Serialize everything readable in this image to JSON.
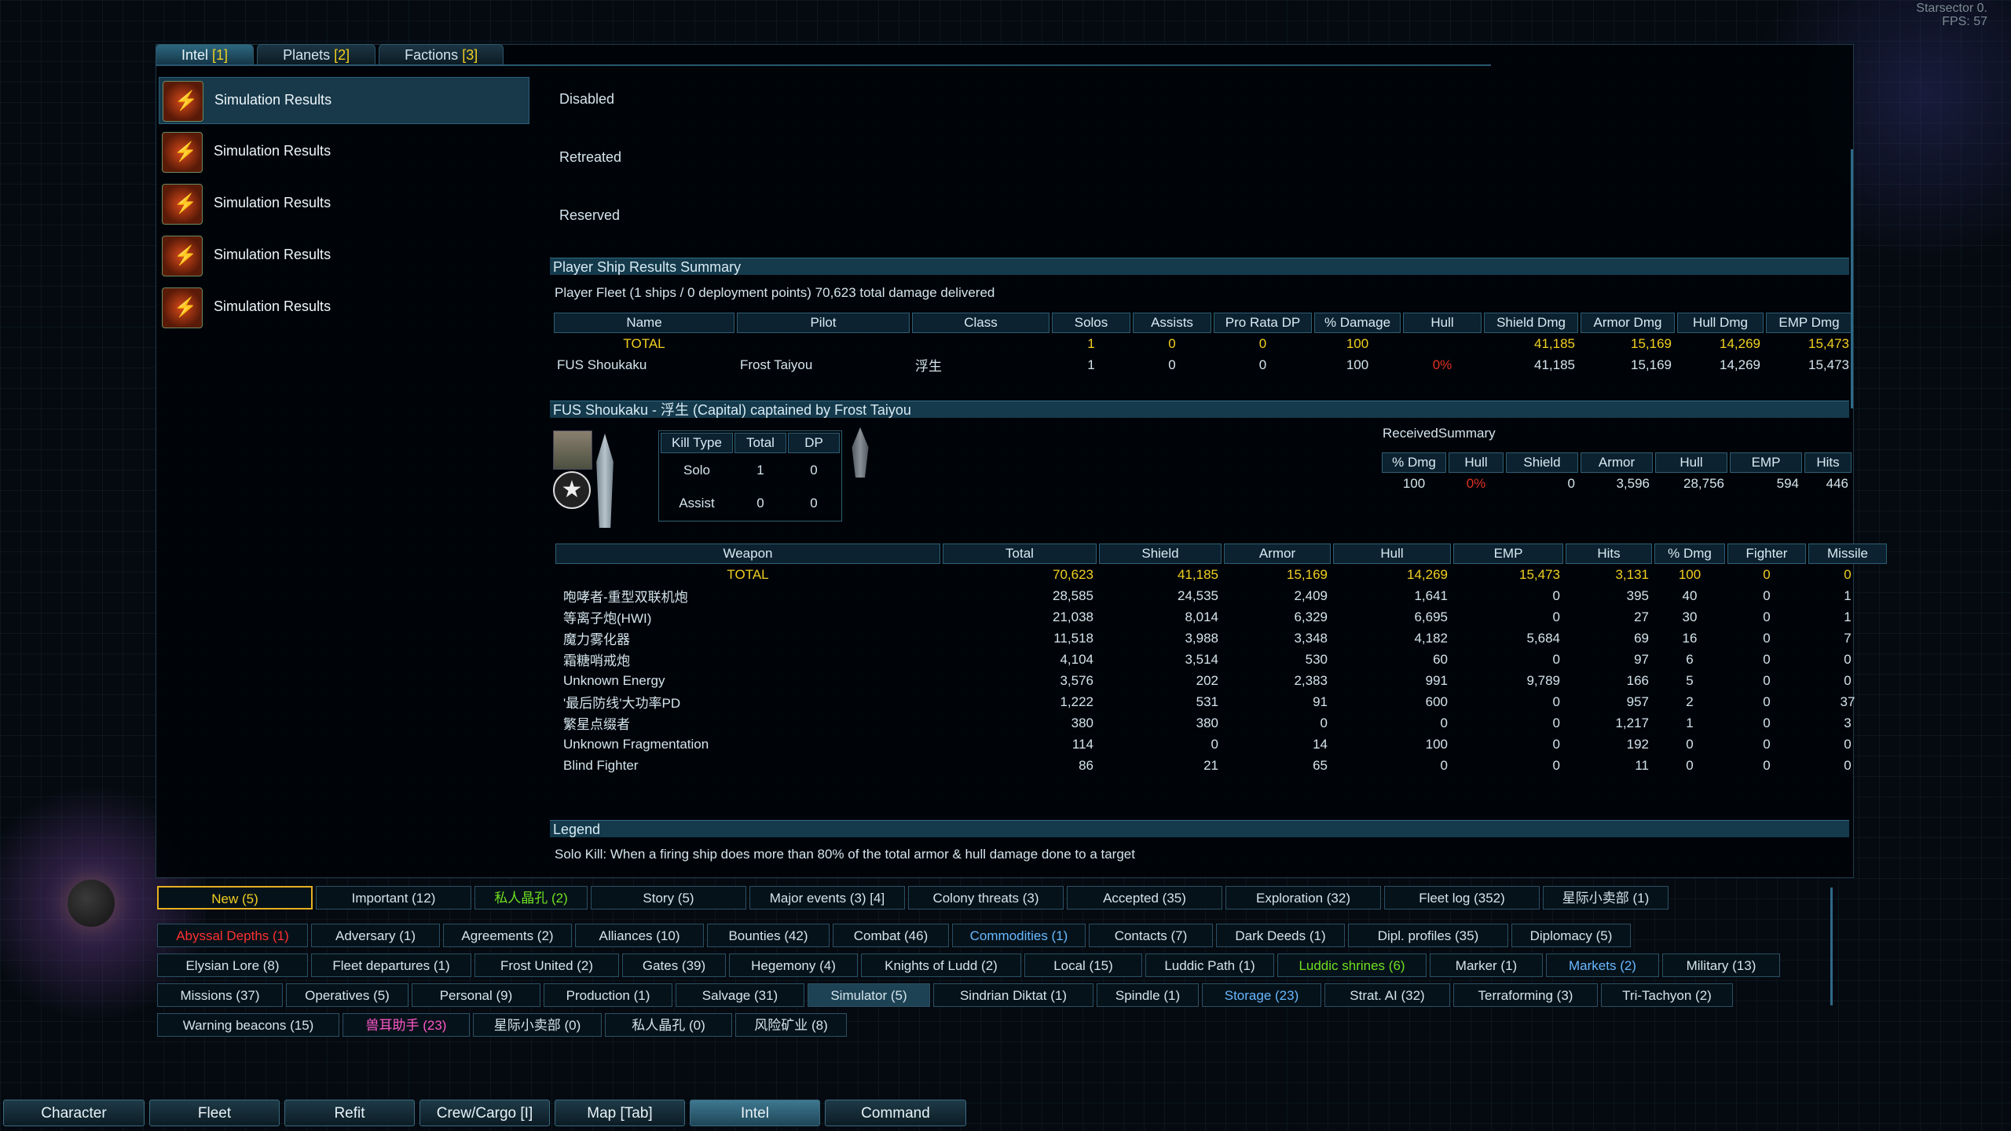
{
  "hud": {
    "game": "Starsector 0.",
    "fps_label": "FPS:",
    "fps_value": "57"
  },
  "top_tabs": [
    {
      "label": "Intel",
      "count": "[1]"
    },
    {
      "label": "Planets",
      "count": "[2]"
    },
    {
      "label": "Factions",
      "count": "[3]"
    }
  ],
  "intel_items": [
    "Simulation Results",
    "Simulation Results",
    "Simulation Results",
    "Simulation Results",
    "Simulation Results"
  ],
  "status_labels": [
    "Disabled",
    "Retreated",
    "Reserved"
  ],
  "summary": {
    "header": "Player Ship Results Summary",
    "fleet_line": "Player Fleet (1 ships / 0 deployment points) 70,623 total damage delivered",
    "columns": [
      "Name",
      "Pilot",
      "Class",
      "Solos",
      "Assists",
      "Pro Rata DP",
      "% Damage",
      "Hull",
      "Shield Dmg",
      "Armor Dmg",
      "Hull Dmg",
      "EMP Dmg"
    ],
    "total_row": [
      "TOTAL",
      "",
      "",
      "1",
      "0",
      "0",
      "100",
      "",
      "41,185",
      "15,169",
      "14,269",
      "15,473"
    ],
    "rows": [
      [
        "FUS Shoukaku",
        "Frost Taiyou",
        "浮生",
        "1",
        "0",
        "0",
        "100",
        "0%",
        "41,185",
        "15,169",
        "14,269",
        "15,473"
      ]
    ]
  },
  "ship_detail": {
    "header": "FUS Shoukaku - 浮生 (Capital) captained by Frost Taiyou",
    "kill_columns": [
      "Kill Type",
      "Total",
      "DP"
    ],
    "kill_rows": [
      [
        "Solo",
        "1",
        "0"
      ],
      [
        "Assist",
        "0",
        "0"
      ]
    ],
    "received_title": "ReceivedSummary",
    "received_columns": [
      "% Dmg",
      "Hull",
      "Shield",
      "Armor",
      "Hull",
      "EMP",
      "Hits"
    ],
    "received_row": [
      "100",
      "0%",
      "0",
      "3,596",
      "28,756",
      "594",
      "446"
    ],
    "weapon_columns": [
      "Weapon",
      "Total",
      "Shield",
      "Armor",
      "Hull",
      "EMP",
      "Hits",
      "% Dmg",
      "Fighter",
      "Missile"
    ],
    "weapon_total": [
      "TOTAL",
      "70,623",
      "41,185",
      "15,169",
      "14,269",
      "15,473",
      "3,131",
      "100",
      "0",
      "0"
    ],
    "weapon_rows": [
      [
        "咆哮者-重型双联机炮",
        "28,585",
        "24,535",
        "2,409",
        "1,641",
        "0",
        "395",
        "40",
        "0",
        "1"
      ],
      [
        "等离子炮(HWI)",
        "21,038",
        "8,014",
        "6,329",
        "6,695",
        "0",
        "27",
        "30",
        "0",
        "1"
      ],
      [
        "魔力雾化器",
        "11,518",
        "3,988",
        "3,348",
        "4,182",
        "5,684",
        "69",
        "16",
        "0",
        "7"
      ],
      [
        "霜糖哨戒炮",
        "4,104",
        "3,514",
        "530",
        "60",
        "0",
        "97",
        "6",
        "0",
        "0"
      ],
      [
        "Unknown Energy",
        "3,576",
        "202",
        "2,383",
        "991",
        "9,789",
        "166",
        "5",
        "0",
        "0"
      ],
      [
        "'最后防线'大功率PD",
        "1,222",
        "531",
        "91",
        "600",
        "0",
        "957",
        "2",
        "0",
        "37"
      ],
      [
        "繁星点缀者",
        "380",
        "380",
        "0",
        "0",
        "0",
        "1,217",
        "1",
        "0",
        "3"
      ],
      [
        "Unknown Fragmentation",
        "114",
        "0",
        "14",
        "100",
        "0",
        "192",
        "0",
        "0",
        "0"
      ],
      [
        "Blind Fighter",
        "86",
        "21",
        "65",
        "0",
        "0",
        "11",
        "0",
        "0",
        "0"
      ]
    ]
  },
  "legend": {
    "header": "Legend",
    "text": "Solo Kill: When a firing ship does more than 80% of the total armor & hull damage done to a target"
  },
  "filter_row1": [
    "New (5)",
    "Important (12)",
    "私人晶孔 (2)",
    "Story (5)",
    "Major events (3) [4]",
    "Colony threats (3)",
    "Accepted (35)",
    "Exploration (32)",
    "Fleet log (352)",
    "星际小卖部 (1)"
  ],
  "filter_row2": [
    "Abyssal Depths (1)",
    "Adversary (1)",
    "Agreements (2)",
    "Alliances (10)",
    "Bounties (42)",
    "Combat (46)",
    "Commodities (1)",
    "Contacts (7)",
    "Dark Deeds (1)",
    "Dipl. profiles (35)",
    "Diplomacy (5)"
  ],
  "filter_row3": [
    "Elysian Lore (8)",
    "Fleet departures (1)",
    "Frost United (2)",
    "Gates (39)",
    "Hegemony (4)",
    "Knights of Ludd (2)",
    "Local (15)",
    "Luddic Path (1)",
    "Luddic shrines (6)",
    "Marker (1)",
    "Markets (2)",
    "Military (13)"
  ],
  "filter_row4": [
    "Missions (37)",
    "Operatives (5)",
    "Personal (9)",
    "Production (1)",
    "Salvage (31)",
    "Simulator (5)",
    "Sindrian Diktat (1)",
    "Spindle (1)",
    "Storage (23)",
    "Strat. AI (32)",
    "Terraforming (3)",
    "Tri-Tachyon (2)"
  ],
  "filter_row5": [
    "Warning beacons (15)",
    "兽耳助手 (23)",
    "星际小卖部 (0)",
    "私人晶孔 (0)",
    "风险矿业 (8)"
  ],
  "bottom_nav": [
    "Character",
    "Fleet",
    "Refit",
    "Crew/Cargo [I]",
    "Map [Tab]",
    "Intel",
    "Command"
  ]
}
